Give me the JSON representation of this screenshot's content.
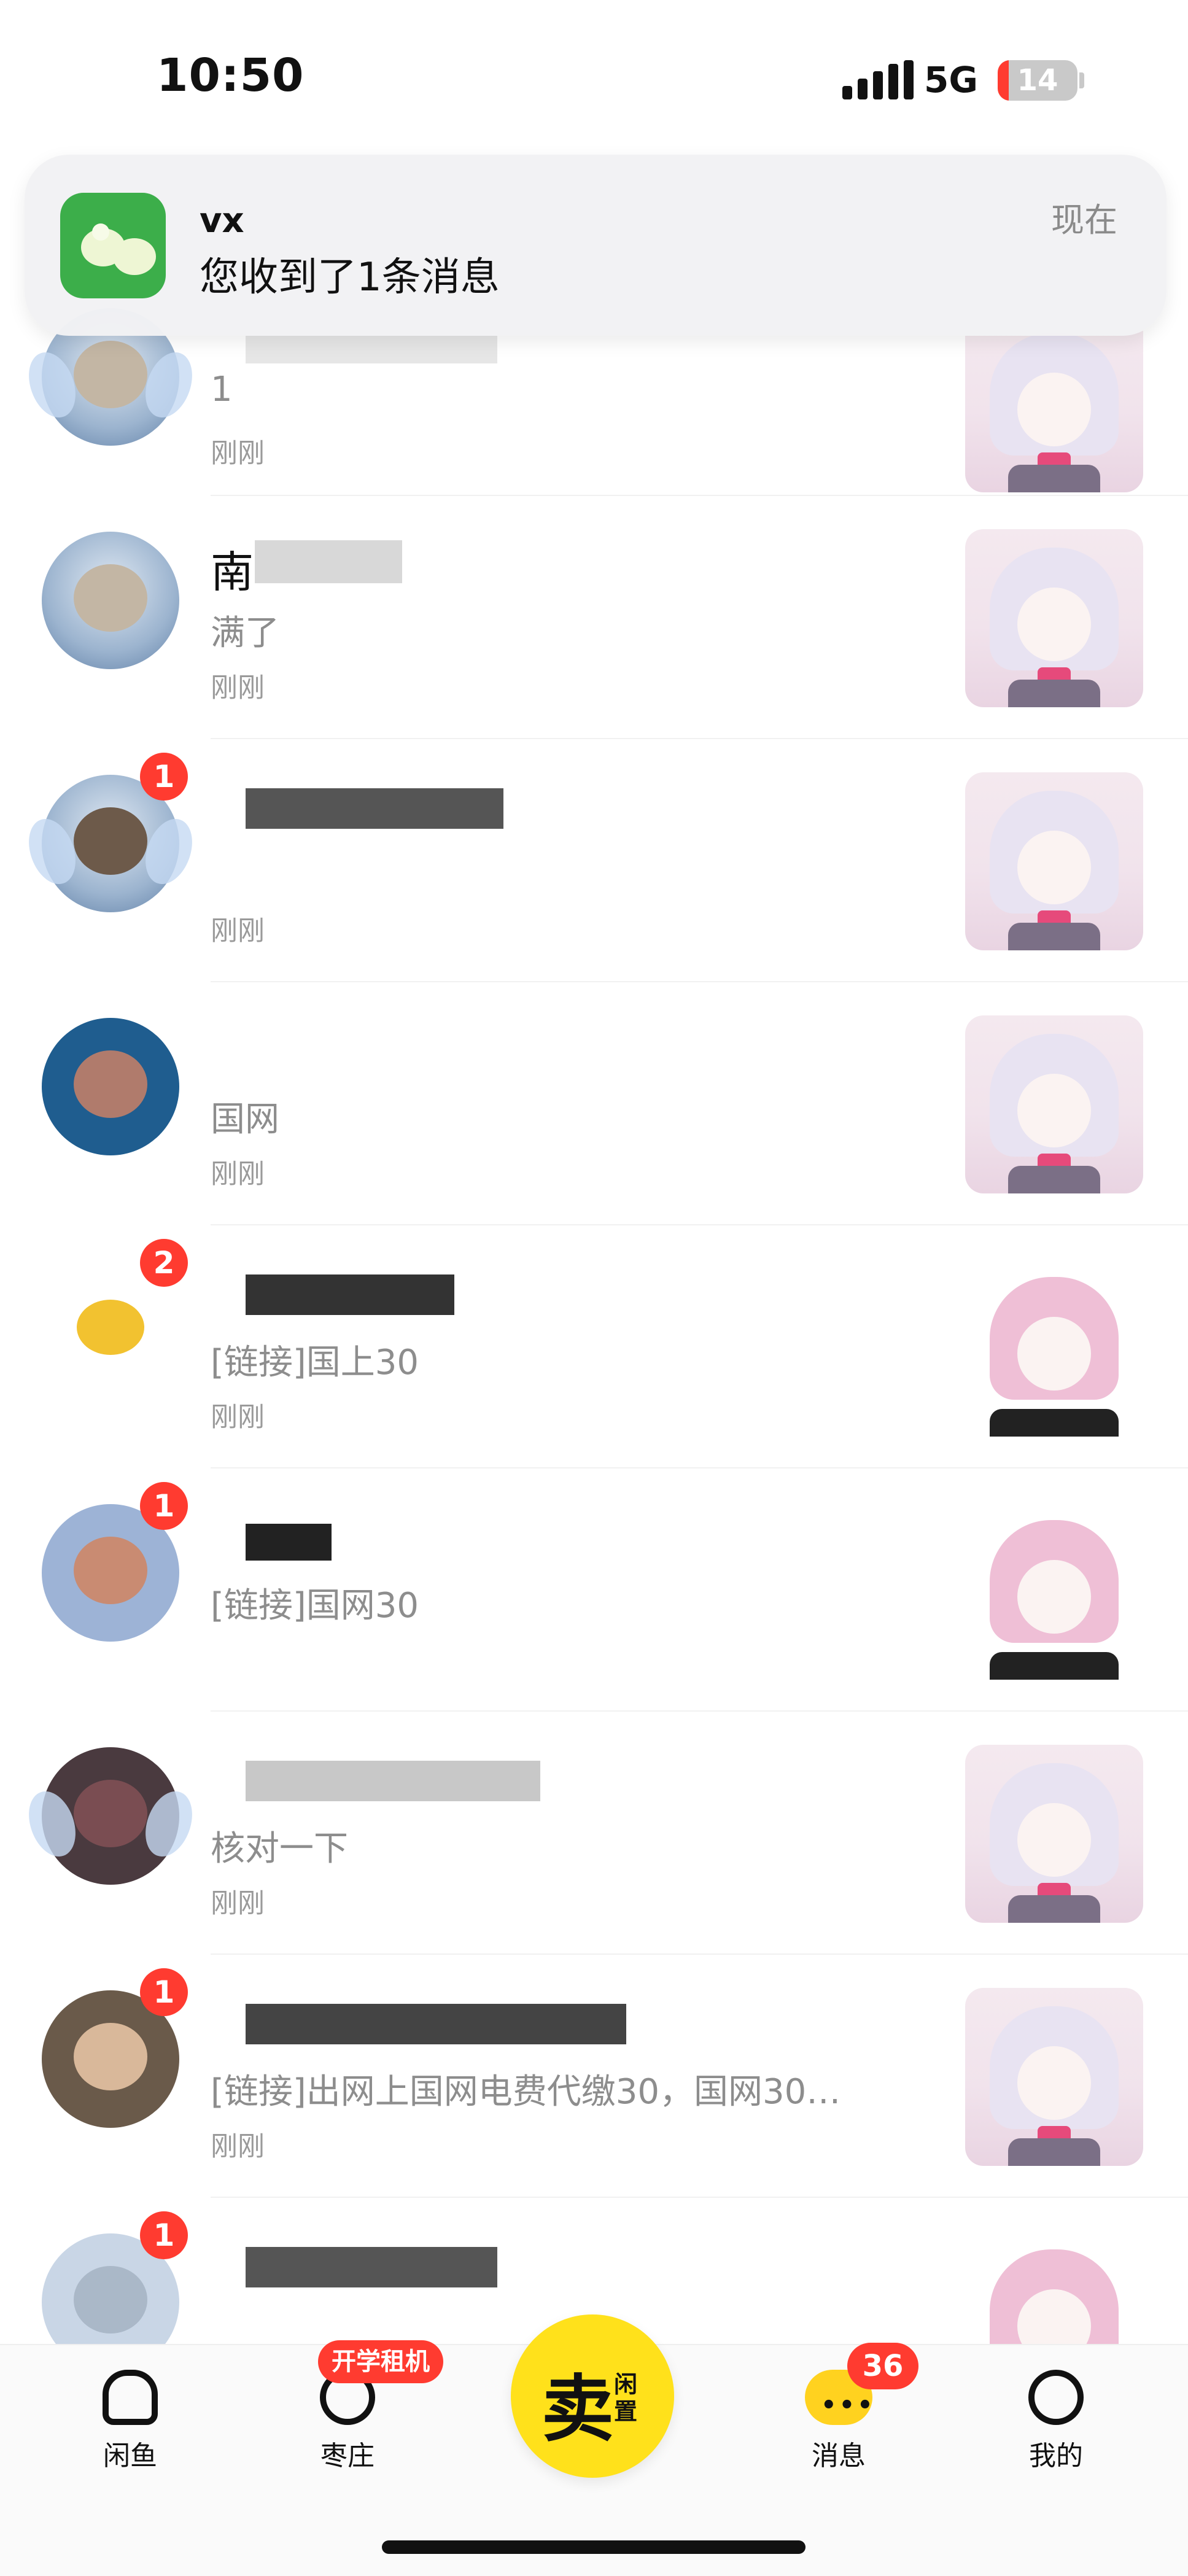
{
  "status_bar": {
    "time": "10:50",
    "network": "5G",
    "battery": "14",
    "battery_level": 0.14
  },
  "notification": {
    "app": "vx",
    "body": "您收到了1条消息",
    "time": "现在"
  },
  "messages": [
    {
      "name": "",
      "preview": "1",
      "time": "刚刚",
      "badge": ""
    },
    {
      "name": "南",
      "preview": "满了",
      "time": "刚刚",
      "badge": ""
    },
    {
      "name": "",
      "preview": "",
      "time": "刚刚",
      "badge": "1"
    },
    {
      "name": "",
      "preview": "国网",
      "time": "刚刚",
      "badge": ""
    },
    {
      "name": "",
      "preview": "[链接]国上30",
      "time": "刚刚",
      "badge": "2"
    },
    {
      "name": "",
      "preview": "[链接]国网30",
      "time": "",
      "badge": "1"
    },
    {
      "name": "",
      "preview": "核对一下",
      "time": "刚刚",
      "badge": ""
    },
    {
      "name": "",
      "preview": "[链接]出网上国网电费代缴30，国网30…",
      "time": "刚刚",
      "badge": "1"
    },
    {
      "name": "",
      "preview": "",
      "time": "",
      "badge": "1"
    }
  ],
  "bottom_nav": {
    "home": "闲鱼",
    "farm": "枣庄",
    "farm_promo": "开学租机",
    "sell_big": "卖",
    "sell_small": "闲置",
    "messages": "消息",
    "messages_badge": "36",
    "me": "我的"
  },
  "colors": {
    "accent_yellow": "#ffe11b",
    "badge_red": "#ff3b30"
  }
}
